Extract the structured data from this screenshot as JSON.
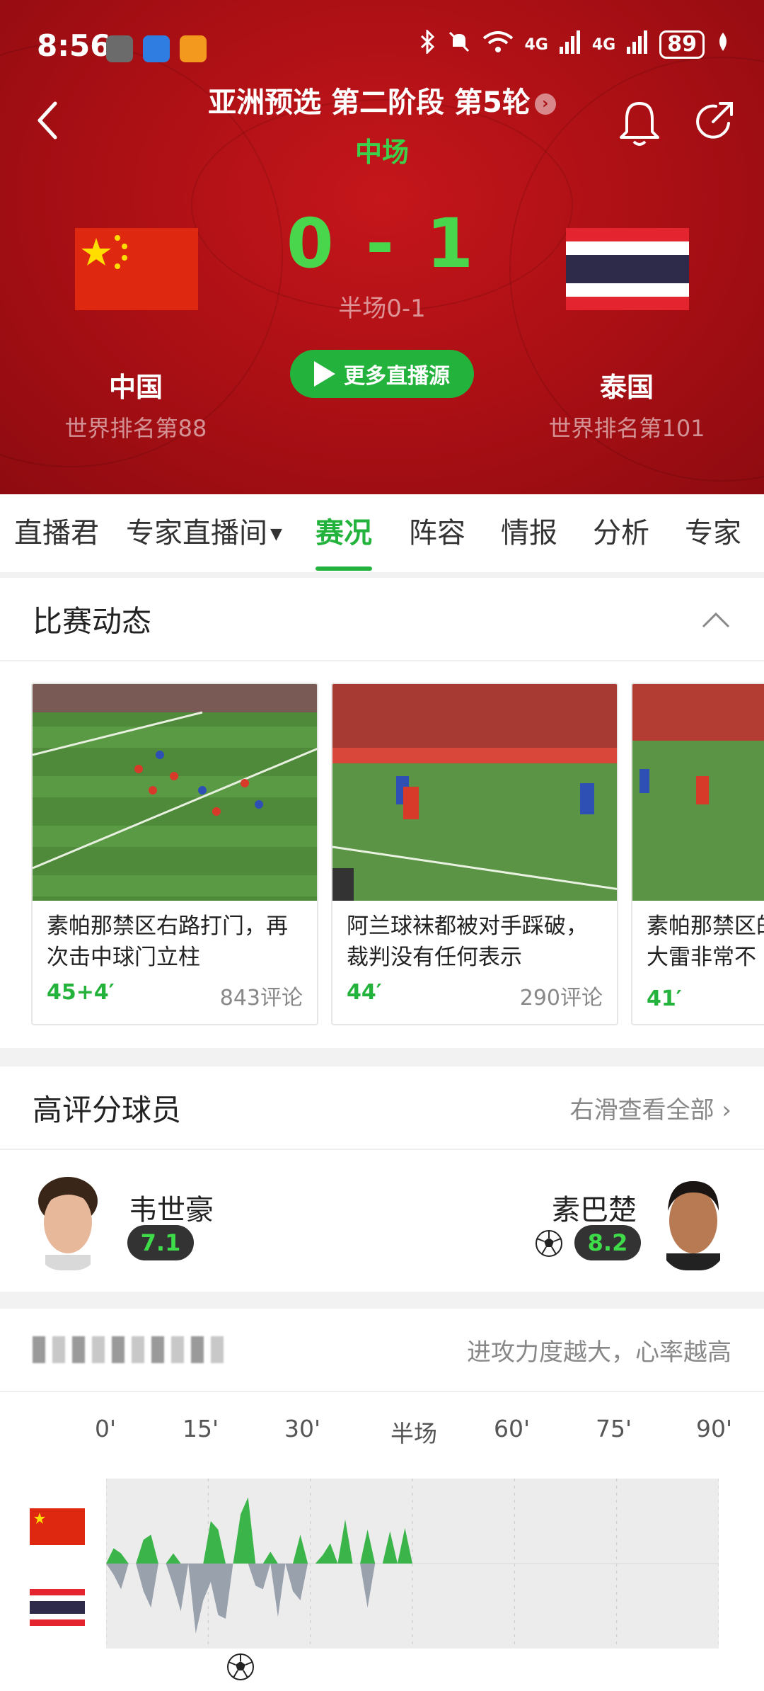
{
  "status_bar": {
    "time": "8:56",
    "network": "4G",
    "network2": "4G",
    "battery": "89"
  },
  "header": {
    "round_title": "亚洲预选 第二阶段 第5轮",
    "phase": "中场",
    "score": "0 - 1",
    "halftime": "半场0-1",
    "live_button": "更多直播源",
    "home": {
      "name": "中国",
      "rank": "世界排名第88"
    },
    "away": {
      "name": "泰国",
      "rank": "世界排名第101"
    },
    "colors": {
      "header_red": "#a80f14",
      "score_green": "#4ad64c"
    }
  },
  "tabs": {
    "items": [
      "直播君",
      "专家直播间",
      "赛况",
      "阵容",
      "情报",
      "分析",
      "专家"
    ],
    "active": "赛况",
    "accent": "#23b33c"
  },
  "events": {
    "title": "比赛动态",
    "cards": [
      {
        "text": "素帕那禁区右路打门，再次击中球门立柱",
        "minute": "45+4′",
        "comments": "843评论"
      },
      {
        "text": "阿兰球袜都被对手踩破，裁判没有任何表示",
        "minute": "44′",
        "comments": "290评论"
      },
      {
        "text": "素帕那禁区的王大雷非常不",
        "minute": "41′",
        "comments": ""
      }
    ]
  },
  "players": {
    "title": "高评分球员",
    "more": "右滑查看全部",
    "home_player": {
      "name": "韦世豪",
      "rating": "7.1"
    },
    "away_player": {
      "name": "素巴楚",
      "rating": "8.2"
    }
  },
  "momentum": {
    "note": "进攻力度越大，心率越高",
    "axis": [
      "0'",
      "15'",
      "30'",
      "半场",
      "60'",
      "75'",
      "90'"
    ]
  },
  "chart_data": {
    "type": "area",
    "x_range": [
      0,
      90
    ],
    "series": [
      {
        "values": [
          0,
          18,
          12,
          0,
          0,
          28,
          34,
          0,
          0,
          12,
          0,
          0,
          0,
          0,
          50,
          40,
          0,
          0,
          58,
          78,
          0,
          0,
          14,
          0,
          0,
          0,
          34,
          0,
          0,
          10,
          24,
          0,
          52,
          0,
          0,
          40,
          0,
          0,
          38,
          0,
          42,
          0
        ]
      },
      {
        "values": [
          0,
          12,
          28,
          0,
          0,
          30,
          48,
          0,
          0,
          24,
          52,
          0,
          76,
          40,
          20,
          56,
          60,
          0,
          0,
          0,
          24,
          28,
          0,
          58,
          0,
          30,
          40,
          0,
          0,
          0,
          0,
          0,
          0,
          0,
          0,
          48,
          0,
          0,
          0,
          0,
          0,
          0
        ]
      }
    ]
  }
}
